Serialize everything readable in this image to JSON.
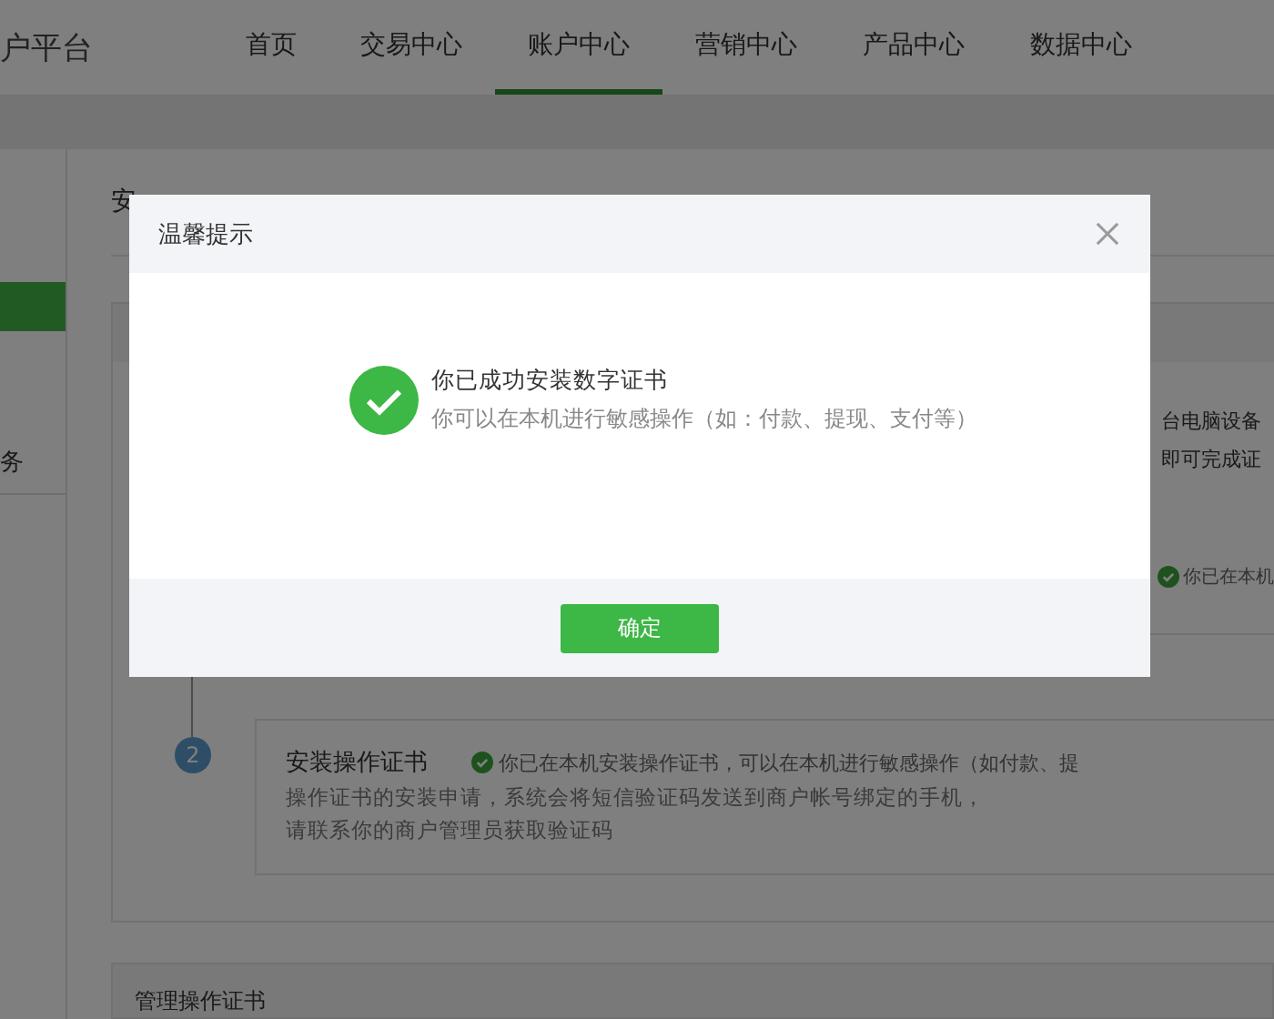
{
  "header": {
    "brand": "户平台",
    "nav": [
      {
        "label": "首页",
        "selected": false
      },
      {
        "label": "交易中心",
        "selected": false
      },
      {
        "label": "账户中心",
        "selected": true
      },
      {
        "label": "营销中心",
        "selected": false
      },
      {
        "label": "产品中心",
        "selected": false
      },
      {
        "label": "数据中心",
        "selected": false
      }
    ]
  },
  "sidebar": {
    "items": [
      {
        "selected": true
      },
      {
        "label": "务",
        "selected": false
      }
    ]
  },
  "main": {
    "title": "安",
    "step1": {
      "lines": [
        "台电脑设备",
        "即可完成证"
      ],
      "status": "你已在本机"
    },
    "step2": {
      "number": "2",
      "title": "安装操作证书",
      "status": "你已在本机安装操作证书，可以在本机进行敏感操作（如付款、提",
      "description": [
        "操作证书的安装申请，系统会将短信验证码发送到商户帐号绑定的手机，",
        "请联系你的商户管理员获取验证码"
      ]
    },
    "section_title": "管理操作证书"
  },
  "dialog": {
    "title": "温馨提示",
    "message": "你已成功安装数字证书",
    "detail": "你可以在本机进行敏感操作（如：付款、提现、支付等）",
    "button": "确定"
  }
}
